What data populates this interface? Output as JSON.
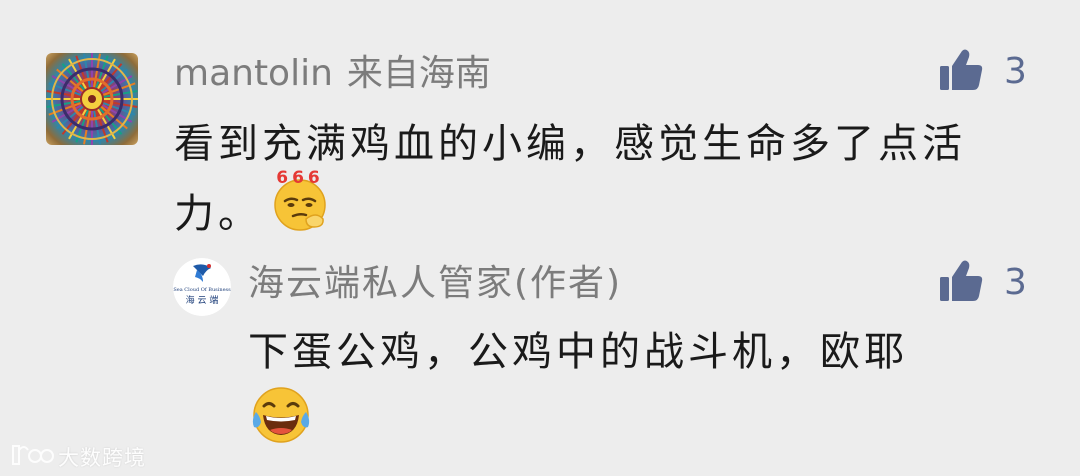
{
  "comment": {
    "username": "mantolin",
    "location": "来自海南",
    "text": "看到充满鸡血的小编，感觉生命多了点活力。",
    "emoji": "666-emoji",
    "likes": "3",
    "like_icon": "thumbs-up-icon"
  },
  "reply": {
    "author": "海云端私人管家(作者)",
    "text": "下蛋公鸡，公鸡中的战斗机，欧耶",
    "emoji": "laughing-tears-emoji",
    "likes": "3",
    "avatar_logo_text": "Sea Cloud Of Business 海 云 端"
  },
  "watermark": {
    "text": "大数跨境",
    "logo": "dashu-logo"
  },
  "colors": {
    "background": "#ededed",
    "meta_text": "#7c7c7c",
    "body_text": "#1a1a1a",
    "like_accent": "#5b6a91"
  }
}
